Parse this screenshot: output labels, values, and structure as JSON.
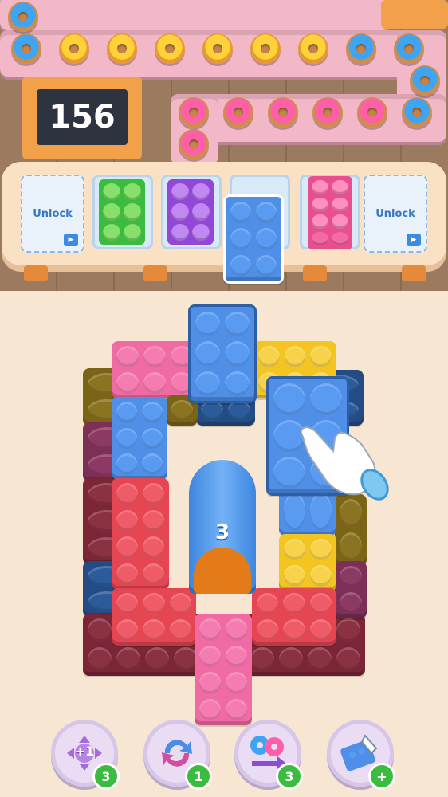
{
  "level_board": {
    "number": "156"
  },
  "slots": [
    {
      "type": "locked",
      "label": "Unlock",
      "icon": "video-icon"
    },
    {
      "type": "box",
      "color": "green",
      "donut_color": "green"
    },
    {
      "type": "box",
      "color": "purple",
      "donut_color": "purple"
    },
    {
      "type": "empty"
    },
    {
      "type": "box",
      "color": "pink",
      "donut_color": "pink"
    },
    {
      "type": "locked",
      "label": "Unlock",
      "icon": "video-icon"
    }
  ],
  "tunnel": {
    "count": "3",
    "color": "blue",
    "next_color": "orange"
  },
  "powerups": [
    {
      "name": "plus-one",
      "icon": "plus-one-dpad-icon",
      "label": "+1",
      "count": "3"
    },
    {
      "name": "shuffle",
      "icon": "refresh-icon",
      "count": "1"
    },
    {
      "name": "swap",
      "icon": "swap-donut-icon",
      "count": "3"
    },
    {
      "name": "pick",
      "icon": "hand-pick-icon",
      "count": "+"
    }
  ],
  "colors": {
    "blue": "#4f8fe8",
    "pink": "#f06ba3",
    "red": "#e64552",
    "yellow": "#f4c520",
    "maroon": "#7c2536",
    "olive": "#7a6516",
    "navy": "#234c84",
    "green": "#3bbb3f"
  }
}
